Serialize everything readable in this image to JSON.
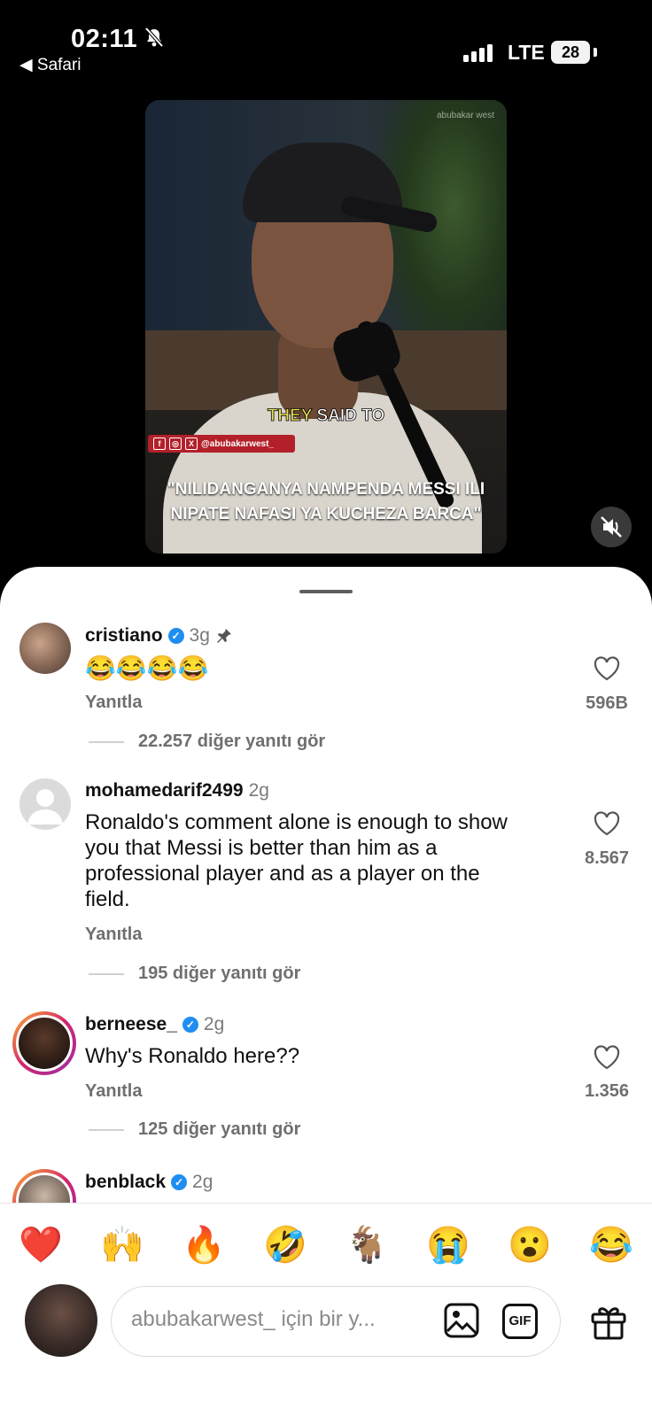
{
  "status_bar": {
    "time": "02:11",
    "back_app": "◀ Safari",
    "network": "LTE",
    "battery": "28"
  },
  "video": {
    "watermark": "abubakar west",
    "overlay_text_1": "THEY",
    "overlay_text_2": "SAID TO",
    "social_handle": "@abubakarwest_",
    "caption_line1": "\"NILIDANGANYA NAMPENDA MESSI ILI",
    "caption_line2": "NIPATE NAFASI YA KUCHEZA BARCA\""
  },
  "comments": [
    {
      "username": "cristiano",
      "verified": true,
      "time": "3g",
      "pinned": true,
      "text": "😂😂😂😂",
      "reply_label": "Yanıtla",
      "likes": "596B",
      "more_replies": "22.257 diğer yanıtı gör"
    },
    {
      "username": "mohamedarif2499",
      "verified": false,
      "time": "2g",
      "text_lines": [
        "Ronaldo's comment alone is enough to show",
        "you that Messi is better than him as a",
        "professional player and as a player on the",
        "field."
      ],
      "reply_label": "Yanıtla",
      "likes": "8.567",
      "more_replies": "195 diğer yanıtı gör"
    },
    {
      "username": "berneese_",
      "verified": true,
      "time": "2g",
      "text": "Why's Ronaldo here??",
      "reply_label": "Yanıtla",
      "likes": "1.356",
      "more_replies": "125 diğer yanıtı gör"
    },
    {
      "username": "benblack",
      "verified": true,
      "time": "2g"
    }
  ],
  "emoji_reactions": [
    "❤️",
    "🙌",
    "🔥",
    "🤣",
    "🐐",
    "😭",
    "😮",
    "😂"
  ],
  "composer": {
    "placeholder": "abubakarwest_ için bir y...",
    "gif_label": "GIF"
  },
  "colors": {
    "verified_blue": "#1f8ef1",
    "story_ring": "#d3246b"
  }
}
